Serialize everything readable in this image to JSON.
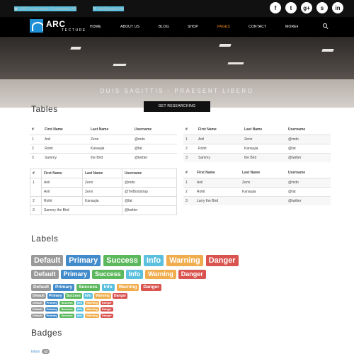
{
  "topbar": {
    "address": "1067 Lorem ipsum, Consectetur, AB",
    "email": "info@gmail.com",
    "socials": [
      {
        "icon": "facebook-icon",
        "glyph": "f"
      },
      {
        "icon": "twitter-icon",
        "glyph": "t"
      },
      {
        "icon": "google-plus-icon",
        "glyph": "g+"
      },
      {
        "icon": "skype-icon",
        "glyph": "s"
      },
      {
        "icon": "linkedin-icon",
        "glyph": "in"
      }
    ]
  },
  "logo": {
    "big": "ARC",
    "small": "TECTURE"
  },
  "nav": {
    "home": "HOME",
    "about": "ABOUT US",
    "blog": "BLOG",
    "shop": "SHOP",
    "pages": "PAGES",
    "contact": "CONTACT",
    "more": "MORE▾",
    "active_color": "#f08a24"
  },
  "hero": {
    "subtitle": "DUIS SAGITTIS - PRAESENT LIBERO",
    "button": "GET RESEARCHING"
  },
  "tables_title": "Tables",
  "tables": {
    "headers": [
      "#",
      "First Name",
      "Last Name",
      "Username"
    ],
    "basic": [
      [
        "1",
        "Anil",
        "Zenn",
        "@mdo"
      ],
      [
        "2",
        "Rohit",
        "Kanaujia",
        "@fat"
      ],
      [
        "3",
        "Sammy",
        "the Bird",
        "@twitter"
      ]
    ],
    "bordered": {
      "r1": [
        "1",
        "Anil",
        "Zenn",
        "@mdo"
      ],
      "r2": [
        "Anil",
        "Zenn",
        "@TwBootstrap"
      ],
      "r3": [
        "2",
        "Rohit",
        "Kanaujia",
        "@fat"
      ],
      "r4": [
        "3",
        "Sammy the Bird",
        "@twitter"
      ]
    },
    "striped": {
      "r1": [
        "1",
        "Anil",
        "Zenn",
        "@mdo"
      ],
      "r2": [
        "2",
        "Rohit",
        "Kanaujia",
        "@fat"
      ],
      "r3": [
        "3",
        "Larry the Bird",
        "@twitter"
      ]
    }
  },
  "labels_title": "Labels",
  "labels": {
    "default": "Default",
    "primary": "Primary",
    "success": "Success",
    "info": "Info",
    "warning": "Warning",
    "danger": "Danger"
  },
  "colors": {
    "default": "#999999",
    "primary": "#428bca",
    "success": "#5cb85c",
    "info": "#5bc0de",
    "warning": "#f0ad4e",
    "danger": "#d9534f"
  },
  "badges_title": "Badges",
  "badges": {
    "link": "Inbox",
    "count": "42"
  }
}
